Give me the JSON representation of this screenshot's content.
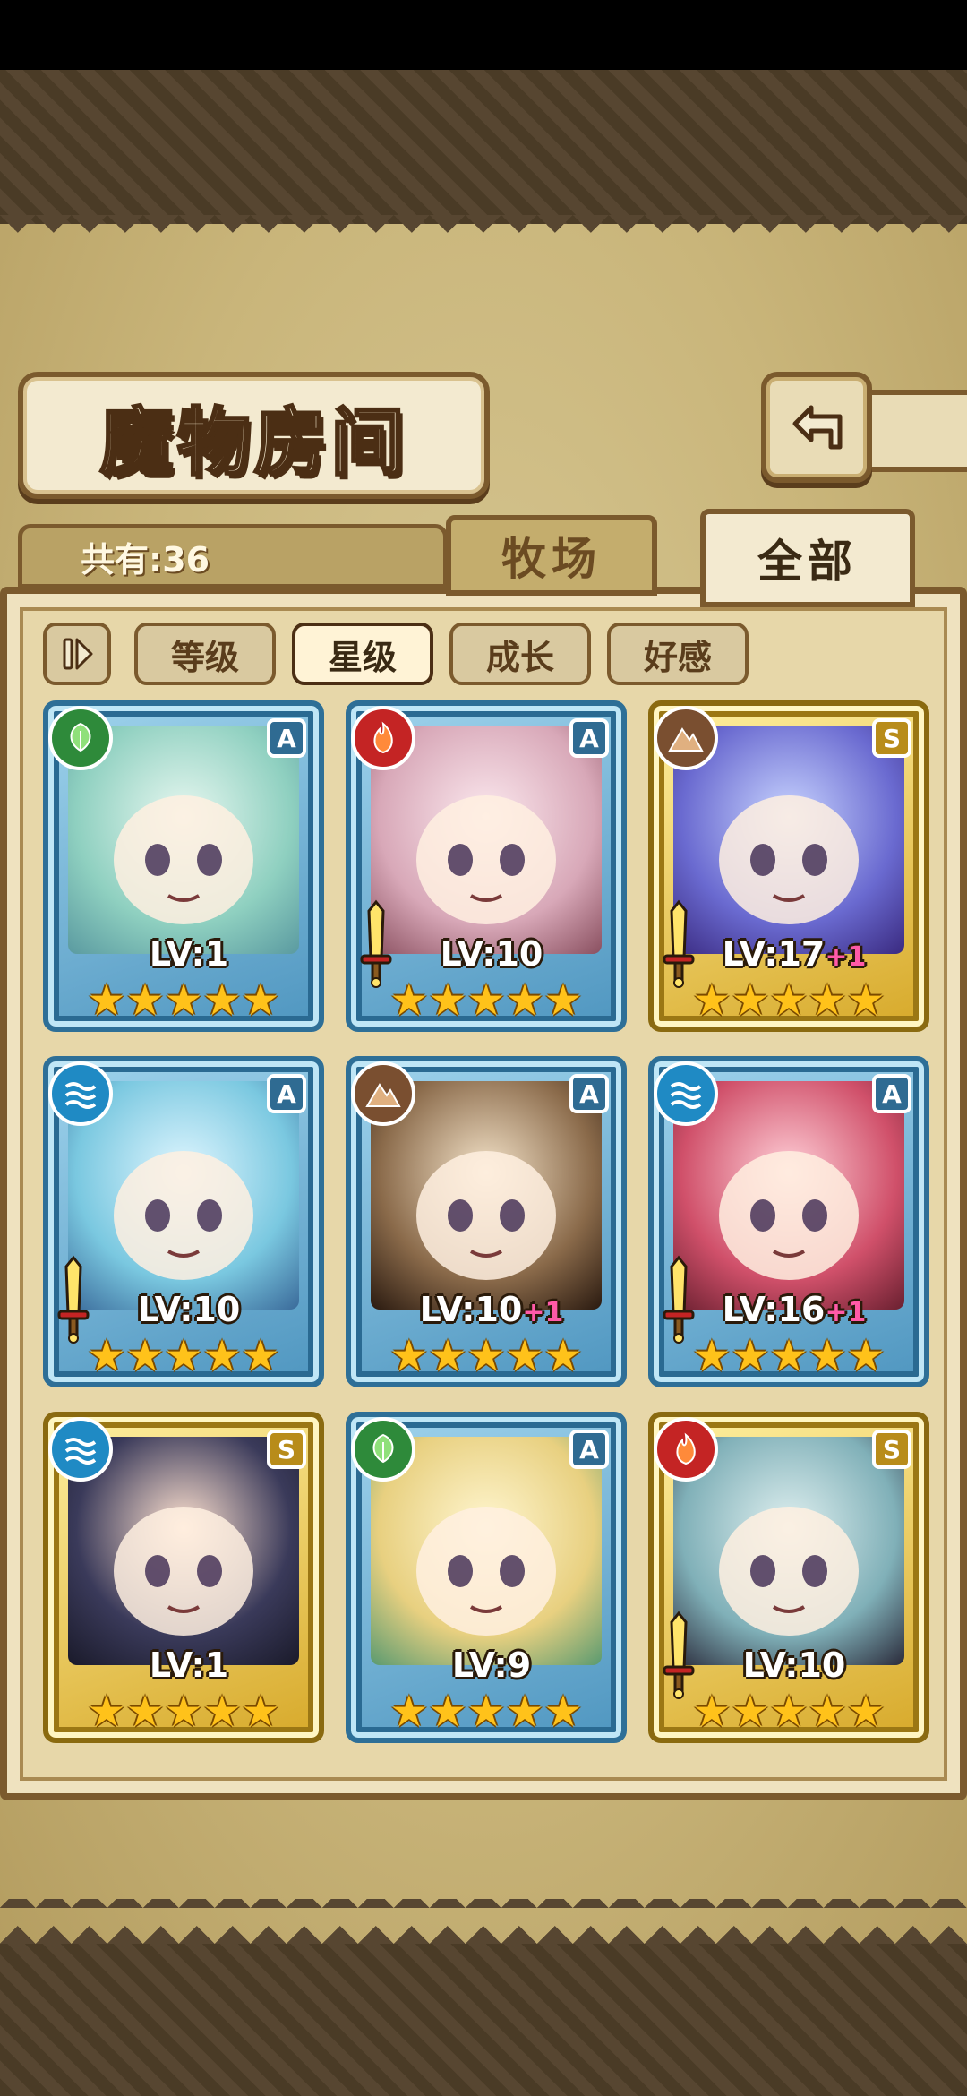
{
  "header": {
    "title": "魔物房间",
    "count_label": "共有:36"
  },
  "tabs": [
    {
      "label": "牧场",
      "active": false
    },
    {
      "label": "全部",
      "active": true
    }
  ],
  "filters": [
    {
      "label": "等级",
      "active": false
    },
    {
      "label": "星级",
      "active": true
    },
    {
      "label": "成长",
      "active": false
    },
    {
      "label": "好感",
      "active": false
    }
  ],
  "colors": {
    "nature": "#2e8a3a",
    "fire": "#c42424",
    "earth": "#7a4f30",
    "water": "#1f8ac4",
    "frame_a": "#2e6f97",
    "frame_s": "#d7a92a",
    "bond_plus": "#ff5aa8"
  },
  "monsters": [
    {
      "level": "LV:1",
      "bonus": "",
      "element": "nature-icon",
      "rank": "A",
      "stars": 5,
      "equipped": false
    },
    {
      "level": "LV:10",
      "bonus": "",
      "element": "fire-icon",
      "rank": "A",
      "stars": 5,
      "equipped": true
    },
    {
      "level": "LV:17",
      "bonus": "+1",
      "element": "earth-icon",
      "rank": "S",
      "stars": 5,
      "equipped": true
    },
    {
      "level": "LV:10",
      "bonus": "",
      "element": "water-icon",
      "rank": "A",
      "stars": 5,
      "equipped": true
    },
    {
      "level": "LV:10",
      "bonus": "+1",
      "element": "earth-icon",
      "rank": "A",
      "stars": 5,
      "equipped": false
    },
    {
      "level": "LV:16",
      "bonus": "+1",
      "element": "water-icon",
      "rank": "A",
      "stars": 5,
      "equipped": true
    },
    {
      "level": "LV:1",
      "bonus": "",
      "element": "water-icon",
      "rank": "S",
      "stars": 5,
      "equipped": false
    },
    {
      "level": "LV:9",
      "bonus": "",
      "element": "nature-icon",
      "rank": "A",
      "stars": 5,
      "equipped": false
    },
    {
      "level": "LV:10",
      "bonus": "",
      "element": "fire-icon",
      "rank": "S",
      "stars": 5,
      "equipped": true
    }
  ]
}
